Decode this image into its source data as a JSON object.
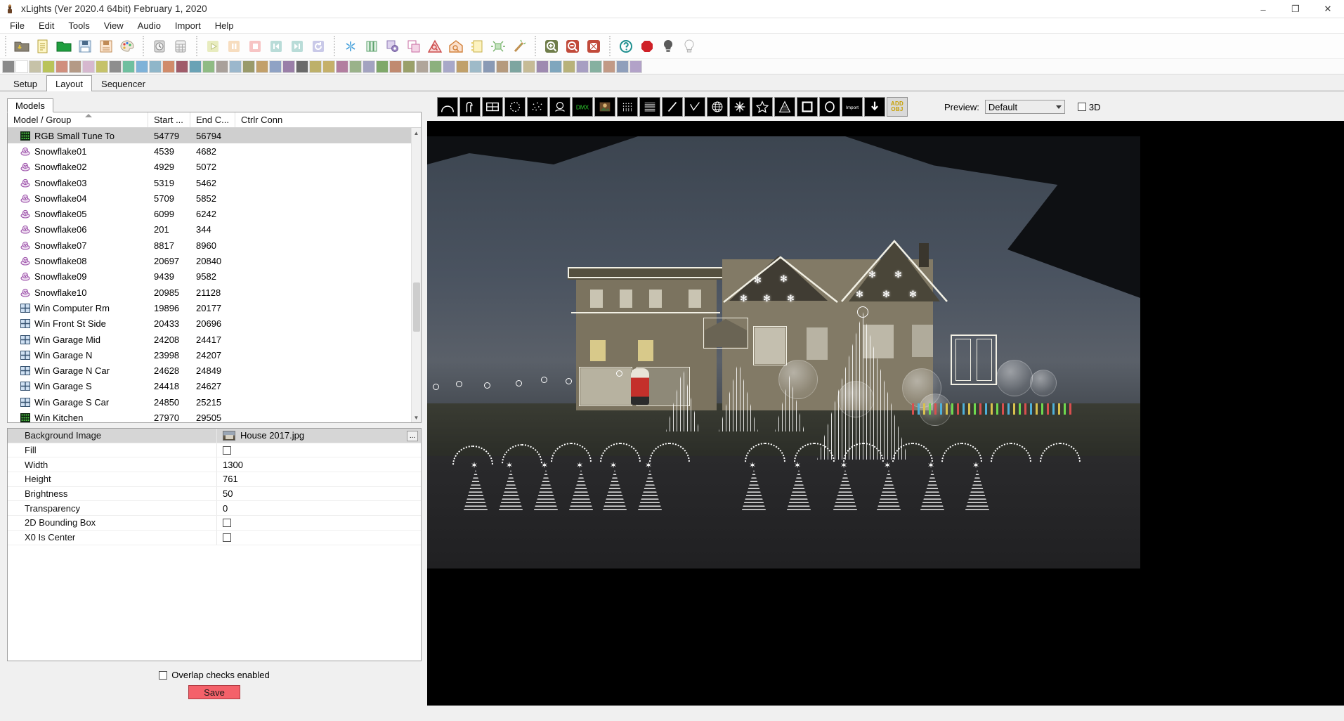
{
  "window": {
    "title": "xLights (Ver 2020.4 64bit) February 1, 2020",
    "app_icon": "xlights-icon",
    "minimize": "–",
    "maximize": "❐",
    "close": "✕"
  },
  "menu": {
    "items": [
      {
        "label": "File",
        "name": "menu-file"
      },
      {
        "label": "Edit",
        "name": "menu-edit"
      },
      {
        "label": "Tools",
        "name": "menu-tools"
      },
      {
        "label": "View",
        "name": "menu-view"
      },
      {
        "label": "Audio",
        "name": "menu-audio"
      },
      {
        "label": "Import",
        "name": "menu-import"
      },
      {
        "label": "Help",
        "name": "menu-help"
      }
    ]
  },
  "toolbar": {
    "groups": [
      {
        "name": "file-group",
        "buttons": [
          {
            "icon": "open-show-folder-icon",
            "tip": "Select Show Folder"
          },
          {
            "icon": "new-sequence-icon",
            "tip": "New Sequence"
          },
          {
            "icon": "open-sequence-icon",
            "tip": "Open Sequence"
          },
          {
            "icon": "save-icon",
            "tip": "Save"
          },
          {
            "icon": "save-as-icon",
            "tip": "Save As"
          },
          {
            "icon": "color-palette-icon",
            "tip": "Render All"
          }
        ]
      },
      {
        "name": "schedule-group",
        "buttons": [
          {
            "icon": "clock-icon",
            "tip": "Scheduler"
          },
          {
            "icon": "grid-sheet-icon",
            "tip": "Sequence Elements"
          }
        ]
      },
      {
        "name": "playback-group",
        "buttons": [
          {
            "icon": "play-icon",
            "tip": "Play"
          },
          {
            "icon": "pause-icon",
            "tip": "Pause"
          },
          {
            "icon": "stop-icon",
            "tip": "Stop"
          },
          {
            "icon": "rewind-icon",
            "tip": "First Frame"
          },
          {
            "icon": "fast-forward-icon",
            "tip": "Last Frame"
          },
          {
            "icon": "replay-icon",
            "tip": "Replay"
          }
        ]
      },
      {
        "name": "effects-group",
        "buttons": [
          {
            "icon": "snowflake-effect-icon",
            "tip": "Effect Settings"
          },
          {
            "icon": "batteries-icon",
            "tip": "Effect Presets"
          },
          {
            "icon": "layers-gear-icon",
            "tip": "Layer Settings"
          },
          {
            "icon": "layers-icon",
            "tip": "Layer Blending"
          },
          {
            "icon": "zoom-triangle-icon",
            "tip": "Model Preview"
          },
          {
            "icon": "house-zoom-icon",
            "tip": "House Preview"
          },
          {
            "icon": "notes-icon",
            "tip": "Effect Assist"
          },
          {
            "icon": "sparkle-icon",
            "tip": "Select Effect"
          },
          {
            "icon": "magic-wand-icon",
            "tip": "Value Curves"
          }
        ]
      },
      {
        "name": "zoom-group",
        "buttons": [
          {
            "icon": "zoom-in-icon",
            "tip": "Zoom In"
          },
          {
            "icon": "zoom-out-icon",
            "tip": "Zoom Out"
          },
          {
            "icon": "fit-to-window-icon",
            "tip": "Fit to Window"
          }
        ]
      },
      {
        "name": "misc-group",
        "buttons": [
          {
            "icon": "help-icon",
            "tip": "Help"
          },
          {
            "icon": "record-icon",
            "tip": "Record"
          },
          {
            "icon": "bulb-off-icon",
            "tip": "Output to Lights Off"
          },
          {
            "icon": "bulb-on-icon",
            "tip": "Output to Lights On"
          }
        ]
      }
    ],
    "effect_palette": [
      "#8a8a8a",
      "#ffffff",
      "#c6c2a8",
      "#b9c35a",
      "#d08f7e",
      "#b49a86",
      "#d6b8cf",
      "#c5c26a",
      "#8e8e8e",
      "#6fbf9f",
      "#7fb2d8",
      "#8fb6c9",
      "#d08b6a",
      "#a05c6a",
      "#6aa2b5",
      "#8fbb84",
      "#a9a09a",
      "#9bb7cc",
      "#9a9a6a",
      "#c2a06a",
      "#8fa2c4",
      "#9a7fa8",
      "#6a6a6a",
      "#bdb06a",
      "#c5b06a",
      "#b27ea0",
      "#9ab28a",
      "#a3a3c0",
      "#7fa86a",
      "#c08a70",
      "#9aa06a",
      "#b0a59a",
      "#8cb07e",
      "#a8a8c8",
      "#c0a06a",
      "#9ebac8",
      "#8a9ab5",
      "#b59a7e",
      "#7ea5a0",
      "#c6bb96",
      "#9e8ab0",
      "#7fa6bd",
      "#b8b27a",
      "#a79ec2",
      "#86b0a0",
      "#c29a86",
      "#8f9fbb",
      "#b2a2c8"
    ]
  },
  "tabs": {
    "items": [
      {
        "label": "Setup",
        "name": "tab-setup",
        "active": false
      },
      {
        "label": "Layout",
        "name": "tab-layout",
        "active": true
      },
      {
        "label": "Sequencer",
        "name": "tab-sequencer",
        "active": false
      }
    ]
  },
  "models_panel": {
    "tab_label": "Models",
    "columns": [
      "Model / Group",
      "Start ...",
      "End C...",
      "Ctrlr Conn"
    ],
    "sort_column": "Model / Group",
    "rows": [
      {
        "icon": "matrix-model-icon",
        "name": "RGB Small Tune To",
        "start": "54779",
        "end": "56794",
        "conn": "",
        "selected": true
      },
      {
        "icon": "snowflake-model-icon",
        "name": "Snowflake01",
        "start": "4539",
        "end": "4682",
        "conn": ""
      },
      {
        "icon": "snowflake-model-icon",
        "name": "Snowflake02",
        "start": "4929",
        "end": "5072",
        "conn": ""
      },
      {
        "icon": "snowflake-model-icon",
        "name": "Snowflake03",
        "start": "5319",
        "end": "5462",
        "conn": ""
      },
      {
        "icon": "snowflake-model-icon",
        "name": "Snowflake04",
        "start": "5709",
        "end": "5852",
        "conn": ""
      },
      {
        "icon": "snowflake-model-icon",
        "name": "Snowflake05",
        "start": "6099",
        "end": "6242",
        "conn": ""
      },
      {
        "icon": "snowflake-model-icon",
        "name": "Snowflake06",
        "start": "201",
        "end": "344",
        "conn": ""
      },
      {
        "icon": "snowflake-model-icon",
        "name": "Snowflake07",
        "start": "8817",
        "end": "8960",
        "conn": ""
      },
      {
        "icon": "snowflake-model-icon",
        "name": "Snowflake08",
        "start": "20697",
        "end": "20840",
        "conn": ""
      },
      {
        "icon": "snowflake-model-icon",
        "name": "Snowflake09",
        "start": "9439",
        "end": "9582",
        "conn": ""
      },
      {
        "icon": "snowflake-model-icon",
        "name": "Snowflake10",
        "start": "20985",
        "end": "21128",
        "conn": ""
      },
      {
        "icon": "window-model-icon",
        "name": "Win Computer Rm",
        "start": "19896",
        "end": "20177",
        "conn": ""
      },
      {
        "icon": "window-model-icon",
        "name": "Win Front St Side",
        "start": "20433",
        "end": "20696",
        "conn": ""
      },
      {
        "icon": "window-model-icon",
        "name": "Win Garage Mid",
        "start": "24208",
        "end": "24417",
        "conn": ""
      },
      {
        "icon": "window-model-icon",
        "name": "Win Garage N",
        "start": "23998",
        "end": "24207",
        "conn": ""
      },
      {
        "icon": "window-model-icon",
        "name": "Win Garage N Car",
        "start": "24628",
        "end": "24849",
        "conn": ""
      },
      {
        "icon": "window-model-icon",
        "name": "Win Garage S",
        "start": "24418",
        "end": "24627",
        "conn": ""
      },
      {
        "icon": "window-model-icon",
        "name": "Win Garage S Car",
        "start": "24850",
        "end": "25215",
        "conn": ""
      },
      {
        "icon": "matrix-model-icon",
        "name": "Win Kitchen",
        "start": "27970",
        "end": "29505",
        "conn": ""
      }
    ]
  },
  "properties": {
    "rows": [
      {
        "key": "Background Image",
        "value": "House 2017.jpg",
        "type": "file",
        "name": "prop-background-image"
      },
      {
        "key": "Fill",
        "value": "",
        "type": "checkbox",
        "checked": false,
        "name": "prop-fill"
      },
      {
        "key": "Width",
        "value": "1300",
        "type": "text",
        "name": "prop-width"
      },
      {
        "key": "Height",
        "value": "761",
        "type": "text",
        "name": "prop-height"
      },
      {
        "key": "Brightness",
        "value": "50",
        "type": "text",
        "name": "prop-brightness"
      },
      {
        "key": "Transparency",
        "value": "0",
        "type": "text",
        "name": "prop-transparency"
      },
      {
        "key": "2D Bounding Box",
        "value": "",
        "type": "checkbox",
        "checked": false,
        "name": "prop-2d-bounding-box"
      },
      {
        "key": "X0 Is Center",
        "value": "",
        "type": "checkbox",
        "checked": false,
        "name": "prop-x0-is-center"
      }
    ],
    "ellipsis_label": "..."
  },
  "footer": {
    "overlap_label": "Overlap checks enabled",
    "overlap_checked": false,
    "save_label": "Save",
    "save_color": "#f4616a"
  },
  "preview_toolbar": {
    "model_buttons": [
      {
        "icon": "arch-model-icon",
        "tip": "Arches"
      },
      {
        "icon": "candy-cane-model-icon",
        "tip": "Candy Canes"
      },
      {
        "icon": "cube-model-icon",
        "tip": "Cube"
      },
      {
        "icon": "circle-model-icon",
        "tip": "Circle"
      },
      {
        "icon": "spinner-model-icon",
        "tip": "Spinner"
      },
      {
        "icon": "custom-model-icon",
        "tip": "Custom"
      },
      {
        "icon": "dmx-model-icon",
        "tip": "DMX"
      },
      {
        "icon": "image-model-icon",
        "tip": "Image"
      },
      {
        "icon": "matrix-model-icon",
        "tip": "Matrix"
      },
      {
        "icon": "grid-model-icon",
        "tip": "Horizontal Matrix"
      },
      {
        "icon": "line-model-icon",
        "tip": "Single Line"
      },
      {
        "icon": "polyline-model-icon",
        "tip": "Poly Line"
      },
      {
        "icon": "sphere-model-icon",
        "tip": "Sphere"
      },
      {
        "icon": "star-burst-model-icon",
        "tip": "Star Burst"
      },
      {
        "icon": "star-model-icon",
        "tip": "Star"
      },
      {
        "icon": "tree-model-icon",
        "tip": "Tree"
      },
      {
        "icon": "window-frame-model-icon",
        "tip": "Window Frame"
      },
      {
        "icon": "wreath-model-icon",
        "tip": "Wreath"
      },
      {
        "icon": "import-model-icon",
        "tip": "Import"
      },
      {
        "icon": "download-model-icon",
        "tip": "Download"
      }
    ],
    "add_object_label_top": "ADD",
    "add_object_label_bottom": "OBJ",
    "preview_label": "Preview:",
    "preview_value": "Default",
    "preview_options": [
      "Default"
    ],
    "threeD_label": "3D",
    "threeD_checked": false
  },
  "preview_scene": {
    "description": "House photo background with lit Christmas light models overlaid",
    "snowflake_count": 10,
    "arch_count": 12,
    "mini_tree_count": 12,
    "handle_count": 8
  },
  "colors": {
    "accent_red": "#f4616a",
    "selection_gray": "#cfcfcf",
    "header_gray": "#d6d6d6",
    "light_white": "#f2f0e4"
  }
}
